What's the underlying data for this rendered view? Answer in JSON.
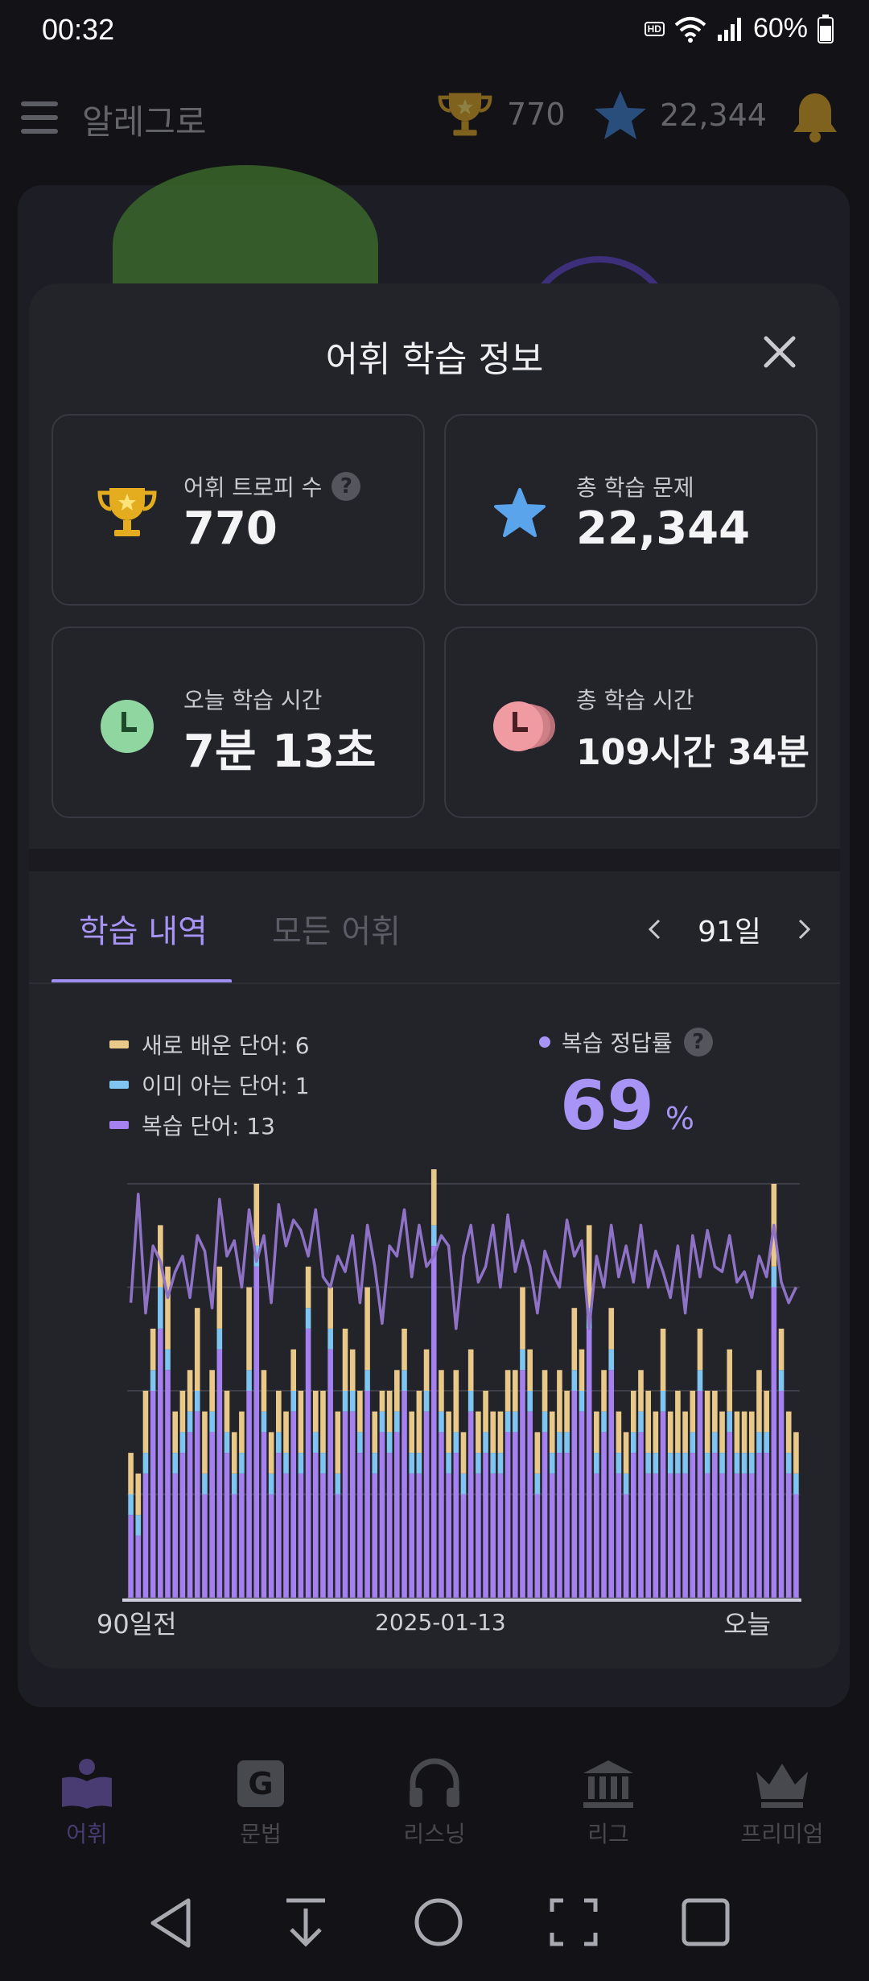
{
  "status_bar": {
    "time": "00:32",
    "battery": "60%",
    "hd_label": "HD"
  },
  "app_bar": {
    "title": "알레그로",
    "trophies": "770",
    "stars": "22,344"
  },
  "modal": {
    "title": "어휘 학습 정보",
    "cards": {
      "trophy": {
        "label": "어휘 트로피 수",
        "value": "770"
      },
      "total_problems": {
        "label": "총 학습 문제",
        "value": "22,344"
      },
      "today_time": {
        "label": "오늘 학습 시간",
        "value": "7분 13초"
      },
      "total_time": {
        "label": "총 학습 시간",
        "value": "109시간 34분"
      }
    },
    "tabs": [
      "학습 내역",
      "모든 어휘"
    ],
    "range_label": "91일",
    "legend": [
      {
        "label": "새로 배운 단어: 6",
        "color": "#e9c98a"
      },
      {
        "label": "이미 아는 단어: 1",
        "color": "#80c4f2"
      },
      {
        "label": "복습 단어: 13",
        "color": "#a580ef"
      }
    ],
    "accuracy": {
      "label": "복습 정답률",
      "value": "69",
      "unit": "%"
    }
  },
  "chart_data": {
    "type": "bar",
    "stacked": true,
    "x_start_label": "90일전",
    "x_mid_label": "2025-01-13",
    "x_end_label": "오늘",
    "colors": {
      "new": "#e9c98a",
      "known": "#80c4f2",
      "review": "#a580ef",
      "accuracy": "#8e72c6"
    },
    "series": [
      {
        "name": "새로 배운 단어",
        "values": [
          2,
          2,
          3,
          2,
          3,
          4,
          2,
          2,
          2,
          4,
          3,
          2,
          3,
          2,
          2,
          2,
          4,
          3,
          2,
          2,
          2,
          2,
          2,
          3,
          2,
          2,
          3,
          2,
          3,
          3,
          2,
          2,
          4,
          2,
          1,
          2,
          2,
          2,
          2,
          3,
          2,
          4,
          2,
          2,
          3,
          2,
          2,
          2,
          2,
          2,
          2,
          2,
          2,
          3,
          2,
          2,
          2,
          2,
          3,
          2,
          3,
          2,
          4,
          2,
          2,
          2,
          2,
          2,
          2,
          2,
          3,
          2,
          3,
          2,
          3,
          2,
          2,
          2,
          3,
          2,
          2,
          3,
          2,
          2,
          2,
          3,
          2,
          4,
          2,
          2,
          2
        ]
      },
      {
        "name": "이미 아는 단어",
        "values": [
          1,
          1,
          1,
          1,
          2,
          1,
          1,
          1,
          1,
          1,
          1,
          1,
          1,
          1,
          1,
          1,
          1,
          1,
          1,
          1,
          1,
          1,
          1,
          1,
          1,
          1,
          1,
          1,
          1,
          1,
          1,
          1,
          1,
          1,
          1,
          1,
          1,
          1,
          1,
          1,
          1,
          1,
          1,
          1,
          1,
          1,
          1,
          1,
          1,
          1,
          1,
          1,
          1,
          1,
          1,
          1,
          1,
          1,
          1,
          1,
          1,
          1,
          1,
          1,
          1,
          1,
          1,
          1,
          1,
          1,
          1,
          1,
          1,
          1,
          1,
          1,
          1,
          1,
          1,
          1,
          1,
          1,
          1,
          1,
          1,
          1,
          1,
          1,
          1,
          1,
          1
        ]
      },
      {
        "name": "복습 단어",
        "values": [
          4,
          3,
          6,
          10,
          13,
          11,
          6,
          7,
          8,
          9,
          5,
          8,
          12,
          7,
          5,
          6,
          10,
          16,
          8,
          5,
          7,
          6,
          9,
          6,
          13,
          7,
          6,
          12,
          5,
          9,
          9,
          7,
          10,
          6,
          8,
          7,
          8,
          10,
          6,
          6,
          9,
          17,
          8,
          6,
          7,
          5,
          9,
          6,
          7,
          6,
          6,
          8,
          8,
          11,
          9,
          5,
          8,
          6,
          7,
          7,
          10,
          9,
          13,
          6,
          8,
          11,
          6,
          5,
          7,
          8,
          6,
          6,
          9,
          6,
          6,
          6,
          7,
          10,
          6,
          7,
          6,
          8,
          6,
          6,
          6,
          7,
          7,
          15,
          10,
          6,
          5
        ]
      },
      {
        "name": "복습 정답률",
        "values": [
          57,
          78,
          55,
          68,
          65,
          58,
          63,
          66,
          58,
          70,
          67,
          56,
          77,
          66,
          69,
          60,
          75,
          65,
          70,
          57,
          76,
          68,
          73,
          71,
          66,
          75,
          62,
          60,
          66,
          63,
          70,
          57,
          72,
          64,
          53,
          68,
          66,
          75,
          62,
          72,
          64,
          66,
          70,
          68,
          52,
          66,
          72,
          61,
          64,
          72,
          60,
          74,
          63,
          69,
          64,
          55,
          67,
          63,
          60,
          73,
          66,
          69,
          52,
          66,
          60,
          72,
          62,
          68,
          61,
          72,
          60,
          67,
          63,
          58,
          68,
          55,
          70,
          62,
          71,
          64,
          63,
          70,
          61,
          63,
          58,
          66,
          62,
          72,
          61,
          57,
          60
        ]
      }
    ],
    "ylim": [
      0,
      20
    ],
    "y2lim": [
      0,
      80
    ],
    "grid": true
  },
  "bottom_nav": [
    "어휘",
    "문법",
    "리스닝",
    "리그",
    "프리미엄"
  ]
}
